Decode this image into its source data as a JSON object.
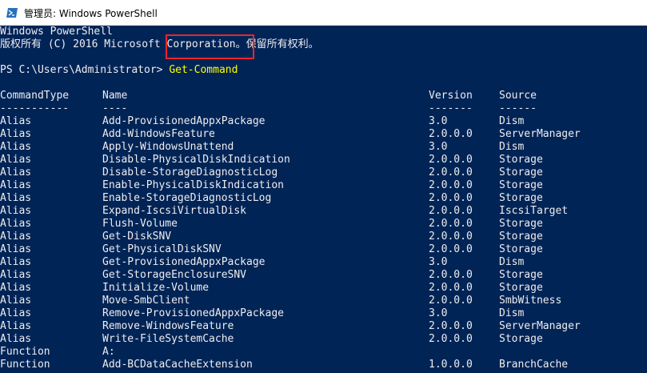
{
  "window": {
    "title": "管理员: Windows PowerShell",
    "icon": "powershell-icon"
  },
  "console": {
    "banner": [
      "Windows PowerShell",
      "版权所有 (C) 2016 Microsoft Corporation。保留所有权利。"
    ],
    "prompt": "PS C:\\Users\\Administrator> ",
    "command": "Get-Command",
    "headers": {
      "type": "CommandType",
      "name": "Name",
      "version": "Version",
      "source": "Source"
    },
    "underlines": {
      "type": "-----------",
      "name": "----",
      "version": "-------",
      "source": "------"
    },
    "rows": [
      {
        "type": "Alias",
        "name": "Add-ProvisionedAppxPackage",
        "version": "3.0",
        "source": "Dism"
      },
      {
        "type": "Alias",
        "name": "Add-WindowsFeature",
        "version": "2.0.0.0",
        "source": "ServerManager"
      },
      {
        "type": "Alias",
        "name": "Apply-WindowsUnattend",
        "version": "3.0",
        "source": "Dism"
      },
      {
        "type": "Alias",
        "name": "Disable-PhysicalDiskIndication",
        "version": "2.0.0.0",
        "source": "Storage"
      },
      {
        "type": "Alias",
        "name": "Disable-StorageDiagnosticLog",
        "version": "2.0.0.0",
        "source": "Storage"
      },
      {
        "type": "Alias",
        "name": "Enable-PhysicalDiskIndication",
        "version": "2.0.0.0",
        "source": "Storage"
      },
      {
        "type": "Alias",
        "name": "Enable-StorageDiagnosticLog",
        "version": "2.0.0.0",
        "source": "Storage"
      },
      {
        "type": "Alias",
        "name": "Expand-IscsiVirtualDisk",
        "version": "2.0.0.0",
        "source": "IscsiTarget"
      },
      {
        "type": "Alias",
        "name": "Flush-Volume",
        "version": "2.0.0.0",
        "source": "Storage"
      },
      {
        "type": "Alias",
        "name": "Get-DiskSNV",
        "version": "2.0.0.0",
        "source": "Storage"
      },
      {
        "type": "Alias",
        "name": "Get-PhysicalDiskSNV",
        "version": "2.0.0.0",
        "source": "Storage"
      },
      {
        "type": "Alias",
        "name": "Get-ProvisionedAppxPackage",
        "version": "3.0",
        "source": "Dism"
      },
      {
        "type": "Alias",
        "name": "Get-StorageEnclosureSNV",
        "version": "2.0.0.0",
        "source": "Storage"
      },
      {
        "type": "Alias",
        "name": "Initialize-Volume",
        "version": "2.0.0.0",
        "source": "Storage"
      },
      {
        "type": "Alias",
        "name": "Move-SmbClient",
        "version": "2.0.0.0",
        "source": "SmbWitness"
      },
      {
        "type": "Alias",
        "name": "Remove-ProvisionedAppxPackage",
        "version": "3.0",
        "source": "Dism"
      },
      {
        "type": "Alias",
        "name": "Remove-WindowsFeature",
        "version": "2.0.0.0",
        "source": "ServerManager"
      },
      {
        "type": "Alias",
        "name": "Write-FileSystemCache",
        "version": "2.0.0.0",
        "source": "Storage"
      },
      {
        "type": "Function",
        "name": "A:",
        "version": "",
        "source": ""
      },
      {
        "type": "Function",
        "name": "Add-BCDataCacheExtension",
        "version": "1.0.0.0",
        "source": "BranchCache"
      }
    ]
  },
  "colors": {
    "console_background": "#012456",
    "console_text": "#eeedf0",
    "command_text": "#ffff00",
    "highlight_border": "#e8262a"
  }
}
